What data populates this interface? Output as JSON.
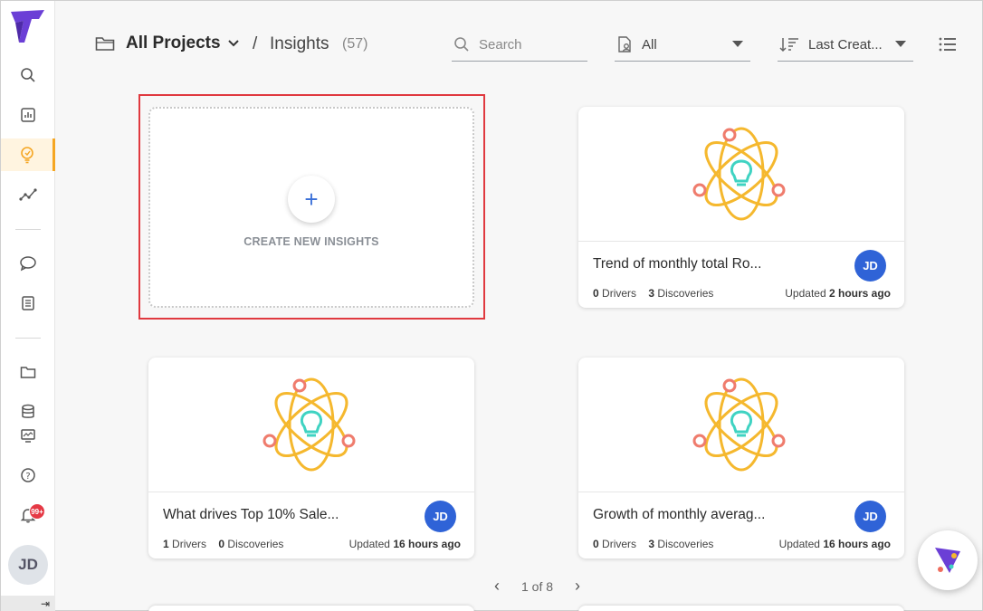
{
  "sidebar": {
    "avatar_initials": "JD",
    "notification_badge": "99+",
    "collapse_glyph": "⇥",
    "icons": [
      "search-icon",
      "dashboard-icon",
      "insights-icon",
      "trend-icon",
      "chat-icon",
      "notebook-icon",
      "folder-icon",
      "database-icon",
      "monitor-icon",
      "help-icon",
      "bell-icon"
    ]
  },
  "header": {
    "project_label": "All Projects",
    "separator": "/",
    "section": "Insights",
    "count": "(57)",
    "search_placeholder": "Search",
    "filter_value": "All",
    "sort_value": "Last Creat..."
  },
  "create_card": {
    "label": "CREATE NEW INSIGHTS",
    "plus": "+"
  },
  "cards": [
    {
      "title": "Trend of monthly total Ro...",
      "drivers_count": "0",
      "drivers_label": "Drivers",
      "discoveries_count": "3",
      "discoveries_label": "Discoveries",
      "updated_prefix": "Updated",
      "updated_time": "2 hours ago",
      "avatar": "JD"
    },
    {
      "title": "What drives Top 10% Sale...",
      "drivers_count": "1",
      "drivers_label": "Drivers",
      "discoveries_count": "0",
      "discoveries_label": "Discoveries",
      "updated_prefix": "Updated",
      "updated_time": "16 hours ago",
      "avatar": "JD"
    },
    {
      "title": "Growth of monthly averag...",
      "drivers_count": "0",
      "drivers_label": "Drivers",
      "discoveries_count": "3",
      "discoveries_label": "Discoveries",
      "updated_prefix": "Updated",
      "updated_time": "16 hours ago",
      "avatar": "JD"
    }
  ],
  "pagination": {
    "text": "1 of 8",
    "prev": "‹",
    "next": "›"
  },
  "colors": {
    "accent": "#f5a623",
    "avatar_blue": "#2f63d7",
    "highlight_red": "#e0393f",
    "brand_purple": "#6b3fd6"
  }
}
